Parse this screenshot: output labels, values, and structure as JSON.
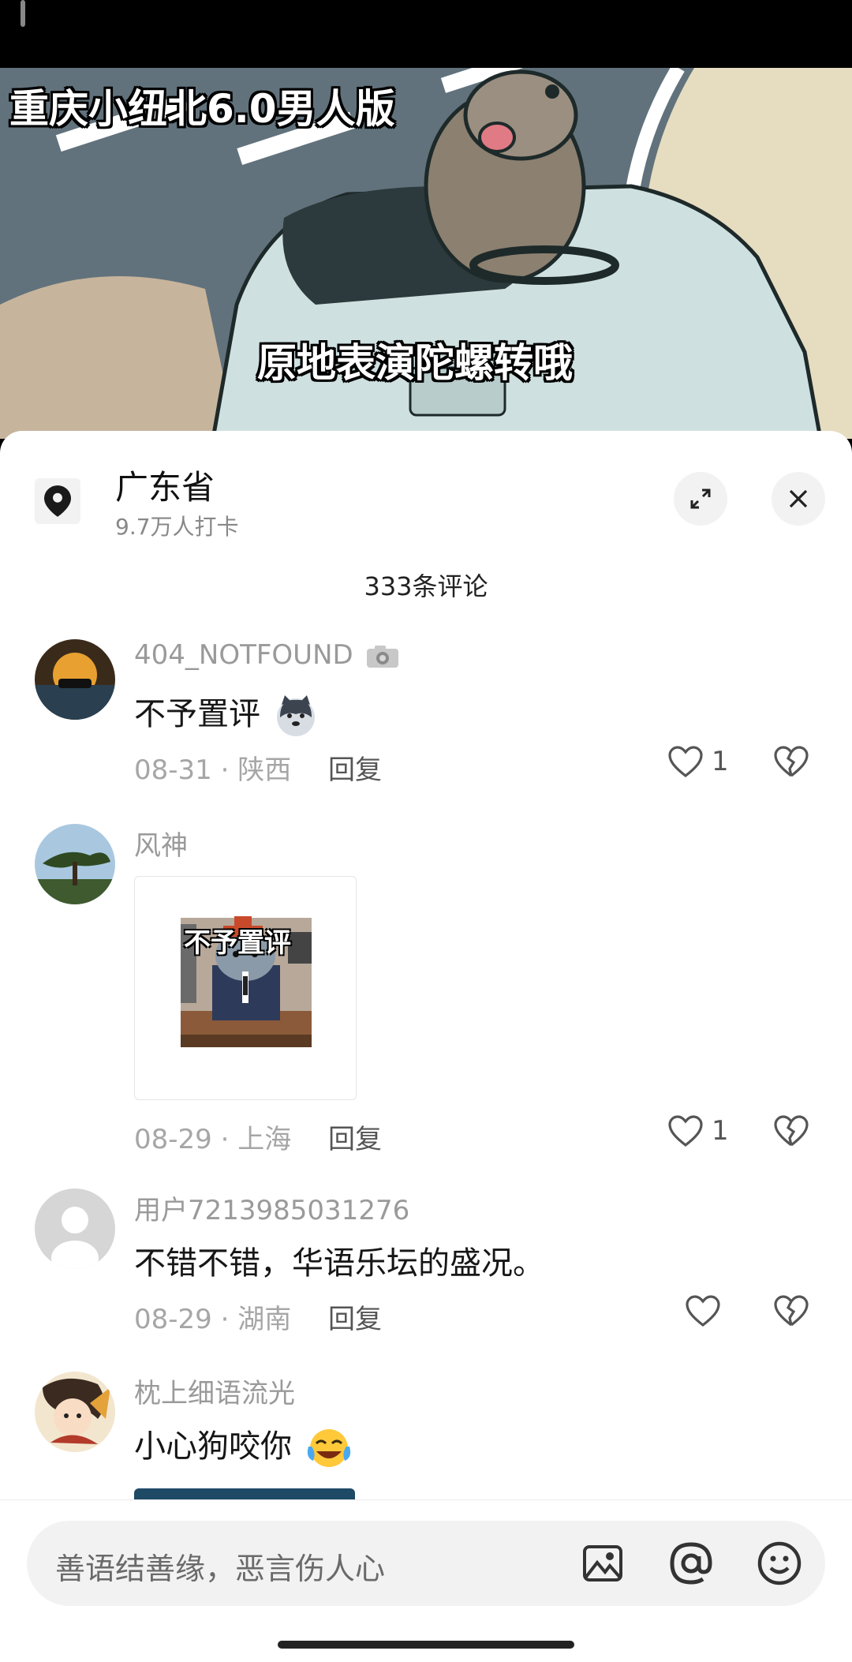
{
  "video": {
    "title": "重庆小纽北6.0男人版",
    "subtitle": "原地表演陀螺转哦"
  },
  "location": {
    "name": "广东省",
    "checkins": "9.7万人打卡"
  },
  "comments_count": "333条评论",
  "comments": [
    {
      "user": "404_NOTFOUND",
      "text": "不予置评",
      "date": "08-31",
      "region": "陕西",
      "reply": "回复",
      "likes": "1"
    },
    {
      "user": "风神",
      "image_caption": "不予置评",
      "date": "08-29",
      "region": "上海",
      "reply": "回复",
      "likes": "1"
    },
    {
      "user": "用户7213985031276",
      "text": "不错不错，华语乐坛的盛况。",
      "date": "08-29",
      "region": "湖南",
      "reply": "回复",
      "likes": ""
    },
    {
      "user": "枕上细语流光",
      "text": "小心狗咬你"
    }
  ],
  "input": {
    "placeholder": "善语结善缘，恶言伤人心"
  },
  "separator": "·",
  "icons": [
    "location-pin-icon",
    "expand-icon",
    "close-icon",
    "camera-icon",
    "heart-icon",
    "broken-heart-icon",
    "image-icon",
    "at-icon",
    "emoji-icon"
  ],
  "colors": {
    "accent": "#161616",
    "muted": "#9a9a9a",
    "sheet": "#ffffff"
  }
}
